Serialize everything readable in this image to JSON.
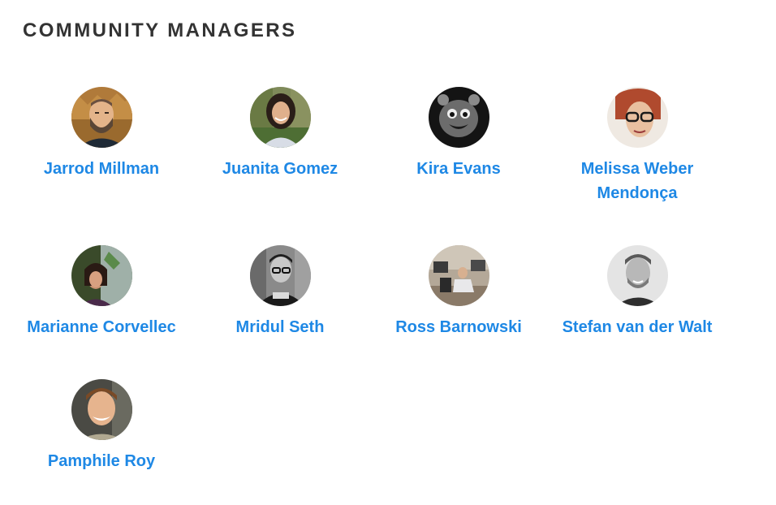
{
  "section": {
    "title": "COMMUNITY MANAGERS"
  },
  "members": [
    {
      "name": "Jarrod Millman",
      "avatar_icon": "person-photo"
    },
    {
      "name": "Juanita Gomez",
      "avatar_icon": "person-photo"
    },
    {
      "name": "Kira Evans",
      "avatar_icon": "cartoon-face-photo"
    },
    {
      "name": "Melissa Weber Mendonça",
      "avatar_icon": "person-photo"
    },
    {
      "name": "Marianne Corvellec",
      "avatar_icon": "person-photo"
    },
    {
      "name": "Mridul Seth",
      "avatar_icon": "person-photo"
    },
    {
      "name": "Ross Barnowski",
      "avatar_icon": "office-photo"
    },
    {
      "name": "Stefan van der Walt",
      "avatar_icon": "person-photo"
    },
    {
      "name": "Pamphile Roy",
      "avatar_icon": "person-photo"
    }
  ],
  "colors": {
    "link": "#1e88e5",
    "heading": "#333333",
    "background": "#ffffff"
  }
}
